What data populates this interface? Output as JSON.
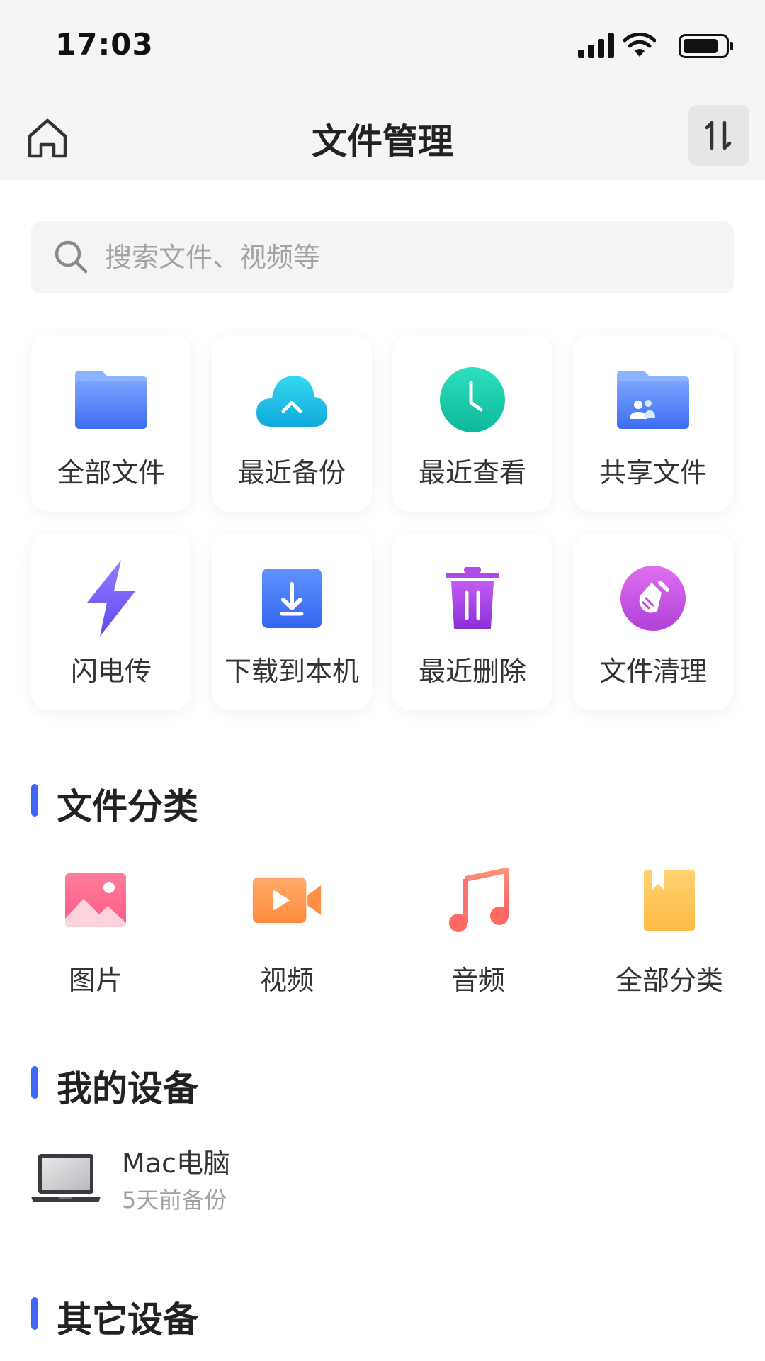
{
  "status_bar": {
    "time": "17:03"
  },
  "nav": {
    "title": "文件管理"
  },
  "search": {
    "placeholder": "搜索文件、视频等"
  },
  "quick_actions": [
    {
      "label": "全部文件",
      "icon": "folder-icon"
    },
    {
      "label": "最近备份",
      "icon": "cloud-backup-icon"
    },
    {
      "label": "最近查看",
      "icon": "clock-icon"
    },
    {
      "label": "共享文件",
      "icon": "shared-folder-icon"
    },
    {
      "label": "闪电传",
      "icon": "lightning-icon"
    },
    {
      "label": "下载到本机",
      "icon": "download-icon"
    },
    {
      "label": "最近删除",
      "icon": "trash-icon"
    },
    {
      "label": "文件清理",
      "icon": "broom-icon"
    }
  ],
  "sections": {
    "categories": "文件分类",
    "my_devices": "我的设备",
    "other_devices": "其它设备"
  },
  "categories": [
    {
      "label": "图片",
      "icon": "image-icon"
    },
    {
      "label": "视频",
      "icon": "video-icon"
    },
    {
      "label": "音频",
      "icon": "music-icon"
    },
    {
      "label": "全部分类",
      "icon": "bookmark-icon"
    }
  ],
  "device": {
    "name": "Mac电脑",
    "subtitle": "5天前备份",
    "icon": "laptop-icon"
  },
  "colors": {
    "accent": "#3f66f5",
    "background": "#f5f5f5"
  }
}
